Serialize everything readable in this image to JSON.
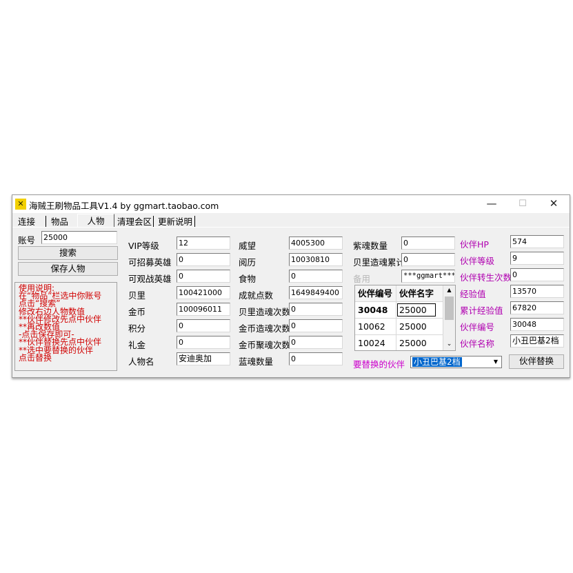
{
  "window": {
    "title": "海贼王刷物品工具V1.4 by ggmart.taobao.com",
    "icon": "app-logo-icon",
    "minimize": "—",
    "maximize": "☐",
    "close": "✕"
  },
  "tabs": [
    {
      "label": "连接"
    },
    {
      "label": "物品"
    },
    {
      "label": "人物",
      "active": true
    },
    {
      "label": "清理会区"
    },
    {
      "label": "更新说明"
    }
  ],
  "left": {
    "account_label": "账号",
    "account_value": "25000",
    "search_button": "搜索",
    "save_button": "保存人物",
    "instructions": [
      "使用说明:",
      "在“物品”栏选中你账号",
      "点击“搜索”",
      "修改右边人物数值",
      "**伙伴修改先点中伙伴",
      "**再改数值",
      "-点击保存即可-",
      "**伙伴替换先点中伙伴",
      "**选中要替换的伙伴",
      "点击替换"
    ]
  },
  "col1": [
    {
      "label": "VIP等级",
      "value": "12"
    },
    {
      "label": "可招募英雄",
      "value": "0"
    },
    {
      "label": "可观战英雄",
      "value": "0"
    },
    {
      "label": "贝里",
      "value": "100421000"
    },
    {
      "label": "金币",
      "value": "100096011"
    },
    {
      "label": "积分",
      "value": "0"
    },
    {
      "label": "礼金",
      "value": "0"
    },
    {
      "label": "人物名",
      "value": "安迪奥加"
    }
  ],
  "col2": [
    {
      "label": "威望",
      "value": "4005300"
    },
    {
      "label": "阅历",
      "value": "10030810"
    },
    {
      "label": "食物",
      "value": "0"
    },
    {
      "label": "成就点数",
      "value": "1649849400"
    },
    {
      "label": "贝里造魂次数",
      "value": "0"
    },
    {
      "label": "金币造魂次数",
      "value": "0"
    },
    {
      "label": "金币聚魂次数",
      "value": "0"
    },
    {
      "label": "蓝魂数量",
      "value": "0"
    }
  ],
  "col3": {
    "purple_soul_label": "紫魂数量",
    "purple_soul_value": "0",
    "berry_soul_total_label": "贝里造魂累计",
    "berry_soul_total_value": "0",
    "reserve_label": "备用",
    "reserve_value": "***ggmart***",
    "grid_headers": [
      "伙伴编号",
      "伙伴名字"
    ],
    "grid_rows": [
      [
        "30048",
        "25000"
      ],
      [
        "10062",
        "25000"
      ],
      [
        "10024",
        "25000"
      ]
    ],
    "replace_label": "要替换的伙伴",
    "replace_selected": "小丑巴基2档"
  },
  "col4": [
    {
      "label": "伙伴HP",
      "value": "574"
    },
    {
      "label": "伙伴等级",
      "value": "9"
    },
    {
      "label": "伙伴转生次数",
      "value": "0"
    },
    {
      "label": "经验值",
      "value": "13570"
    },
    {
      "label": "累计经验值",
      "value": "67820"
    },
    {
      "label": "伙伴编号",
      "value": "30048"
    },
    {
      "label": "伙伴名称",
      "value": "小丑巴基2档"
    }
  ],
  "replace_button": "伙伴替换"
}
